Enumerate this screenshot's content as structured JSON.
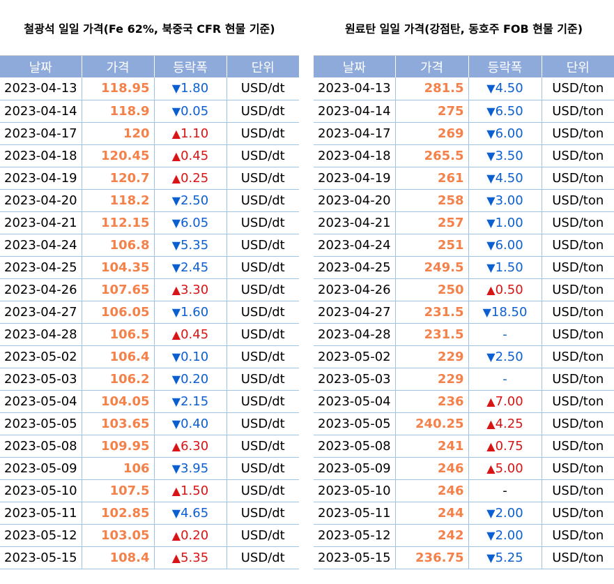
{
  "left": {
    "title": "철광석 일일 가격(Fe 62%, 북중국 CFR 현물 기준)",
    "headers": [
      "날짜",
      "가격",
      "등락폭",
      "단위"
    ],
    "rows": [
      {
        "date": "2023-04-13",
        "price": "118.95",
        "dir": "down",
        "change": "1.80",
        "unit": "USD/dt"
      },
      {
        "date": "2023-04-14",
        "price": "118.9",
        "dir": "down",
        "change": "0.05",
        "unit": "USD/dt"
      },
      {
        "date": "2023-04-17",
        "price": "120",
        "dir": "up",
        "change": "1.10",
        "unit": "USD/dt"
      },
      {
        "date": "2023-04-18",
        "price": "120.45",
        "dir": "up",
        "change": "0.45",
        "unit": "USD/dt"
      },
      {
        "date": "2023-04-19",
        "price": "120.7",
        "dir": "up",
        "change": "0.25",
        "unit": "USD/dt"
      },
      {
        "date": "2023-04-20",
        "price": "118.2",
        "dir": "down",
        "change": "2.50",
        "unit": "USD/dt"
      },
      {
        "date": "2023-04-21",
        "price": "112.15",
        "dir": "down",
        "change": "6.05",
        "unit": "USD/dt"
      },
      {
        "date": "2023-04-24",
        "price": "106.8",
        "dir": "down",
        "change": "5.35",
        "unit": "USD/dt"
      },
      {
        "date": "2023-04-25",
        "price": "104.35",
        "dir": "down",
        "change": "2.45",
        "unit": "USD/dt"
      },
      {
        "date": "2023-04-26",
        "price": "107.65",
        "dir": "up",
        "change": "3.30",
        "unit": "USD/dt"
      },
      {
        "date": "2023-04-27",
        "price": "106.05",
        "dir": "down",
        "change": "1.60",
        "unit": "USD/dt"
      },
      {
        "date": "2023-04-28",
        "price": "106.5",
        "dir": "up",
        "change": "0.45",
        "unit": "USD/dt"
      },
      {
        "date": "2023-05-02",
        "price": "106.4",
        "dir": "down",
        "change": "0.10",
        "unit": "USD/dt"
      },
      {
        "date": "2023-05-03",
        "price": "106.2",
        "dir": "down",
        "change": "0.20",
        "unit": "USD/dt"
      },
      {
        "date": "2023-05-04",
        "price": "104.05",
        "dir": "down",
        "change": "2.15",
        "unit": "USD/dt"
      },
      {
        "date": "2023-05-05",
        "price": "103.65",
        "dir": "down",
        "change": "0.40",
        "unit": "USD/dt"
      },
      {
        "date": "2023-05-08",
        "price": "109.95",
        "dir": "up",
        "change": "6.30",
        "unit": "USD/dt"
      },
      {
        "date": "2023-05-09",
        "price": "106",
        "dir": "down",
        "change": "3.95",
        "unit": "USD/dt"
      },
      {
        "date": "2023-05-10",
        "price": "107.5",
        "dir": "up",
        "change": "1.50",
        "unit": "USD/dt"
      },
      {
        "date": "2023-05-11",
        "price": "102.85",
        "dir": "down",
        "change": "4.65",
        "unit": "USD/dt"
      },
      {
        "date": "2023-05-12",
        "price": "103.05",
        "dir": "up",
        "change": "0.20",
        "unit": "USD/dt"
      },
      {
        "date": "2023-05-15",
        "price": "108.4",
        "dir": "up",
        "change": "5.35",
        "unit": "USD/dt"
      }
    ]
  },
  "right": {
    "title": "원료탄 일일 가격(강점탄, 동호주 FOB 현물 기준)",
    "headers": [
      "날짜",
      "가격",
      "등락폭",
      "단위"
    ],
    "rows": [
      {
        "date": "2023-04-13",
        "price": "281.5",
        "dir": "down",
        "change": "4.50",
        "unit": "USD/ton"
      },
      {
        "date": "2023-04-14",
        "price": "275",
        "dir": "down",
        "change": "6.50",
        "unit": "USD/ton"
      },
      {
        "date": "2023-04-17",
        "price": "269",
        "dir": "down",
        "change": "6.00",
        "unit": "USD/ton"
      },
      {
        "date": "2023-04-18",
        "price": "265.5",
        "dir": "down",
        "change": "3.50",
        "unit": "USD/ton"
      },
      {
        "date": "2023-04-19",
        "price": "261",
        "dir": "down",
        "change": "4.50",
        "unit": "USD/ton"
      },
      {
        "date": "2023-04-20",
        "price": "258",
        "dir": "down",
        "change": "3.00",
        "unit": "USD/ton"
      },
      {
        "date": "2023-04-21",
        "price": "257",
        "dir": "down",
        "change": "1.00",
        "unit": "USD/ton"
      },
      {
        "date": "2023-04-24",
        "price": "251",
        "dir": "down",
        "change": "6.00",
        "unit": "USD/ton"
      },
      {
        "date": "2023-04-25",
        "price": "249.5",
        "dir": "down",
        "change": "1.50",
        "unit": "USD/ton"
      },
      {
        "date": "2023-04-26",
        "price": "250",
        "dir": "up",
        "change": "0.50",
        "unit": "USD/ton"
      },
      {
        "date": "2023-04-27",
        "price": "231.5",
        "dir": "down",
        "change": "18.50",
        "unit": "USD/ton"
      },
      {
        "date": "2023-04-28",
        "price": "231.5",
        "dir": "flat-blue",
        "change": "-",
        "unit": "USD/ton"
      },
      {
        "date": "2023-05-02",
        "price": "229",
        "dir": "down",
        "change": "2.50",
        "unit": "USD/ton"
      },
      {
        "date": "2023-05-03",
        "price": "229",
        "dir": "flat-blue",
        "change": "-",
        "unit": "USD/ton"
      },
      {
        "date": "2023-05-04",
        "price": "236",
        "dir": "up",
        "change": "7.00",
        "unit": "USD/ton"
      },
      {
        "date": "2023-05-05",
        "price": "240.25",
        "dir": "up",
        "change": "4.25",
        "unit": "USD/ton"
      },
      {
        "date": "2023-05-08",
        "price": "241",
        "dir": "up",
        "change": "0.75",
        "unit": "USD/ton"
      },
      {
        "date": "2023-05-09",
        "price": "246",
        "dir": "up",
        "change": "5.00",
        "unit": "USD/ton"
      },
      {
        "date": "2023-05-10",
        "price": "246",
        "dir": "flat-black",
        "change": "-",
        "unit": "USD/ton"
      },
      {
        "date": "2023-05-11",
        "price": "244",
        "dir": "down",
        "change": "2.00",
        "unit": "USD/ton"
      },
      {
        "date": "2023-05-12",
        "price": "242",
        "dir": "down",
        "change": "2.00",
        "unit": "USD/ton"
      },
      {
        "date": "2023-05-15",
        "price": "236.75",
        "dir": "down",
        "change": "5.25",
        "unit": "USD/ton"
      }
    ]
  },
  "symbols": {
    "up": "▲",
    "down": "▼"
  },
  "colors": {
    "header_bg": "#8eaadb",
    "price": "#f4814a",
    "down": "#0b5fd1",
    "up": "#d91414",
    "grid": "#9dc3e6"
  }
}
